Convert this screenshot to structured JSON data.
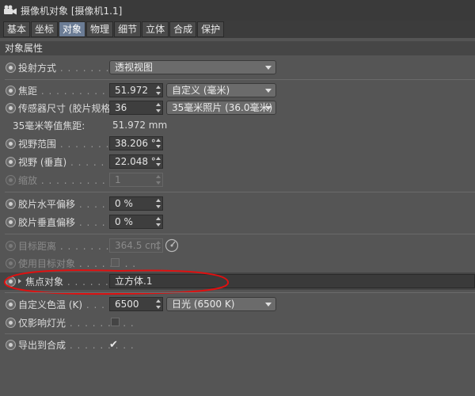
{
  "window": {
    "title": "摄像机对象 [摄像机1.1]"
  },
  "tabs": [
    {
      "label": "基本",
      "active": false
    },
    {
      "label": "坐标",
      "active": false
    },
    {
      "label": "对象",
      "active": true
    },
    {
      "label": "物理",
      "active": false
    },
    {
      "label": "细节",
      "active": false
    },
    {
      "label": "立体",
      "active": false
    },
    {
      "label": "合成",
      "active": false
    },
    {
      "label": "保护",
      "active": false
    }
  ],
  "section": {
    "title": "对象属性"
  },
  "props": {
    "projection": {
      "label": "投射方式",
      "dots": " . . . . . . . . . . .",
      "value": "透视视图"
    },
    "focal_length": {
      "label": "焦距",
      "dots": " . . . . . . . . . . . . . . .",
      "value": "51.972",
      "preset": "自定义 (毫米)"
    },
    "sensor_size": {
      "label": "传感器尺寸 (胶片规格)",
      "value": "36",
      "preset": "35毫米照片 (36.0毫米)"
    },
    "equiv_focal": {
      "label": "35毫米等值焦距:",
      "value": "51.972 mm"
    },
    "fov": {
      "label": "视野范围",
      "dots": " . . . . . . . . . . . .",
      "value": "38.206 °"
    },
    "fov_vertical": {
      "label": "视野 (垂直)",
      "dots": " . . . . . . . . .",
      "value": "22.048 °"
    },
    "zoom": {
      "label": "缩放",
      "dots": " . . . . . . . . . . . . . . .",
      "value": "1"
    },
    "film_h_offset": {
      "label": "胶片水平偏移",
      "dots": " . . . . . . . .",
      "value": "0 %"
    },
    "film_v_offset": {
      "label": "胶片垂直偏移",
      "dots": " . . . . . . . .",
      "value": "0 %"
    },
    "target_distance": {
      "label": "目标距离",
      "dots": " . . . . . . . . . . . .",
      "value": "364.5 cm"
    },
    "use_target": {
      "label": "使用目标对象",
      "dots": " . . . . . . . ."
    },
    "focus_object": {
      "label": "焦点对象",
      "dots": " . . . . . . . . . .",
      "value": "立方体.1"
    },
    "custom_temp": {
      "label": "自定义色温 (K)",
      "dots": " . . . . . .",
      "value": "6500",
      "preset": "日光 (6500 K)"
    },
    "affect_lights": {
      "label": "仅影响灯光",
      "dots": " . . . . . . . . ."
    },
    "export_comp": {
      "label": "导出到合成",
      "dots": " . . . . . . . . .",
      "checkmark": "✔"
    }
  },
  "colors": {
    "active_tab": "#6b7c95",
    "annotation": "#e01010"
  }
}
